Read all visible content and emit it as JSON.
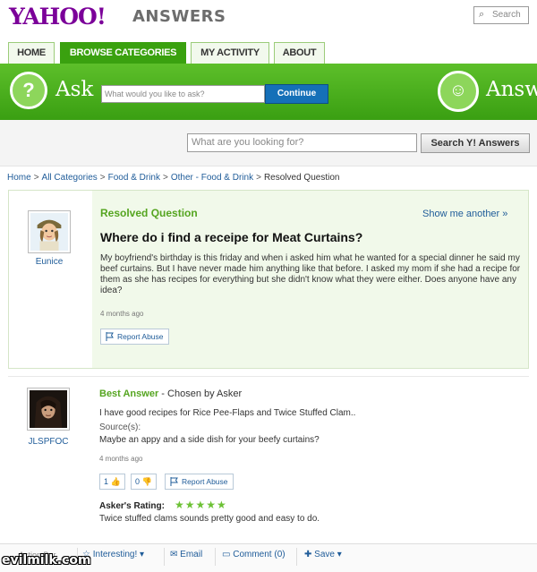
{
  "header": {
    "logo_text": "YAHOO!",
    "logo_sub": "ANSWERS",
    "search_placeholder": "Search"
  },
  "tabs": [
    {
      "label": "HOME"
    },
    {
      "label": "BROWSE CATEGORIES"
    },
    {
      "label": "MY ACTIVITY"
    },
    {
      "label": "ABOUT"
    }
  ],
  "ask_band": {
    "ask_label": "Ask",
    "ask_placeholder": "What would you like to ask?",
    "continue_label": "Continue",
    "answer_label": "Answ"
  },
  "search_bar": {
    "placeholder": "What are you looking for?",
    "button_label": "Search Y! Answers"
  },
  "breadcrumb": {
    "items": [
      "Home",
      "All Categories",
      "Food & Drink",
      "Other - Food & Drink",
      "Resolved Question"
    ],
    "separator": ">"
  },
  "question": {
    "status": "Resolved Question",
    "show_more": "Show me another »",
    "asker": "Eunice",
    "title": "Where do i find a receipe for Meat Curtains?",
    "body": "My boyfriend's birthday is this friday and when i asked him what he wanted for a special dinner he said my beef curtains. But I have never made him anything like that before. I asked my mom if she had a recipe for them as she has recipes for everything but she didn't know what they were either. Does anyone have any idea?",
    "time": "4 months ago",
    "report_label": "Report Abuse"
  },
  "best_answer": {
    "label": "Best Answer",
    "chosen_by": "- Chosen by Asker",
    "answerer": "JLSPFOC",
    "body": "I have good recipes for Rice Pee-Flaps and Twice Stuffed Clam..",
    "sources_label": "Source(s):",
    "sources": "Maybe an appy and a side dish for your beefy curtains?",
    "time": "4 months ago",
    "thumbs_up": "1",
    "thumbs_down": "0",
    "report_label": "Report Abuse",
    "rating_label": "Asker's Rating:",
    "rating_stars": "★★★★★",
    "rating_value": 5,
    "rating_comment": "Twice stuffed clams sounds pretty good and easy to do."
  },
  "action_bar": {
    "label": "Action Bar",
    "interesting": "Interesting!",
    "email": "Email",
    "comment": "Comment (0)",
    "save": "Save"
  },
  "watermark": "evilmilk.com",
  "colors": {
    "brand_purple": "#7b0099",
    "green": "#3aa10f",
    "link_blue": "#1f5c99"
  }
}
